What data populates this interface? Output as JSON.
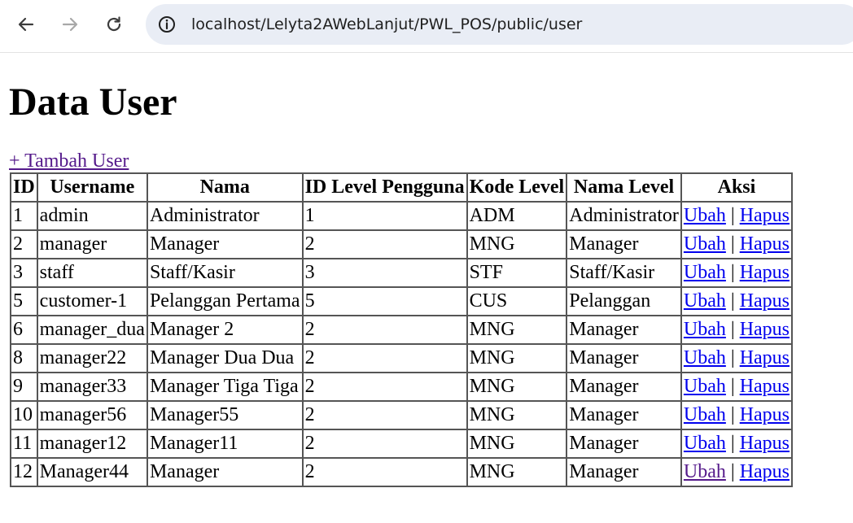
{
  "browser": {
    "url": "localhost/Lelyta2AWebLanjut/PWL_POS/public/user"
  },
  "page": {
    "title": "Data User",
    "add_link": "+ Tambah User"
  },
  "table": {
    "headers": [
      "ID",
      "Username",
      "Nama",
      "ID Level Pengguna",
      "Kode Level",
      "Nama Level",
      "Aksi"
    ],
    "edit_label": "Ubah",
    "delete_label": "Hapus",
    "separator": "|",
    "rows": [
      {
        "id": "1",
        "username": "admin",
        "nama": "Administrator",
        "level_id": "1",
        "level_kode": "ADM",
        "level_nama": "Administrator",
        "edit": "Ubah",
        "sep": "|",
        "delete": "Hapus"
      },
      {
        "id": "2",
        "username": "manager",
        "nama": "Manager",
        "level_id": "2",
        "level_kode": "MNG",
        "level_nama": "Manager",
        "edit": "Ubah",
        "sep": "|",
        "delete": "Hapus"
      },
      {
        "id": "3",
        "username": "staff",
        "nama": "Staff/Kasir",
        "level_id": "3",
        "level_kode": "STF",
        "level_nama": "Staff/Kasir",
        "edit": "Ubah",
        "sep": "|",
        "delete": "Hapus"
      },
      {
        "id": "5",
        "username": "customer-1",
        "nama": "Pelanggan Pertama",
        "level_id": "5",
        "level_kode": "CUS",
        "level_nama": "Pelanggan",
        "edit": "Ubah",
        "sep": "|",
        "delete": "Hapus"
      },
      {
        "id": "6",
        "username": "manager_dua",
        "nama": "Manager 2",
        "level_id": "2",
        "level_kode": "MNG",
        "level_nama": "Manager",
        "edit": "Ubah",
        "sep": "|",
        "delete": "Hapus"
      },
      {
        "id": "8",
        "username": "manager22",
        "nama": "Manager Dua Dua",
        "level_id": "2",
        "level_kode": "MNG",
        "level_nama": "Manager",
        "edit": "Ubah",
        "sep": "|",
        "delete": "Hapus"
      },
      {
        "id": "9",
        "username": "manager33",
        "nama": "Manager Tiga Tiga",
        "level_id": "2",
        "level_kode": "MNG",
        "level_nama": "Manager",
        "edit": "Ubah",
        "sep": "|",
        "delete": "Hapus"
      },
      {
        "id": "10",
        "username": "manager56",
        "nama": "Manager55",
        "level_id": "2",
        "level_kode": "MNG",
        "level_nama": "Manager",
        "edit": "Ubah",
        "sep": "|",
        "delete": "Hapus"
      },
      {
        "id": "11",
        "username": "manager12",
        "nama": "Manager11",
        "level_id": "2",
        "level_kode": "MNG",
        "level_nama": "Manager",
        "edit": "Ubah",
        "sep": "|",
        "delete": "Hapus"
      },
      {
        "id": "12",
        "username": "Manager44",
        "nama": "Manager",
        "level_id": "2",
        "level_kode": "MNG",
        "level_nama": "Manager",
        "edit": "Ubah",
        "sep": "|",
        "delete": "Hapus"
      }
    ]
  },
  "colors": {
    "link": "#0000ee",
    "visited_link": "#551a8b",
    "omnibox_bg": "#e9edf5"
  },
  "icons": [
    "back-arrow-icon",
    "forward-arrow-icon",
    "reload-icon",
    "info-icon"
  ]
}
